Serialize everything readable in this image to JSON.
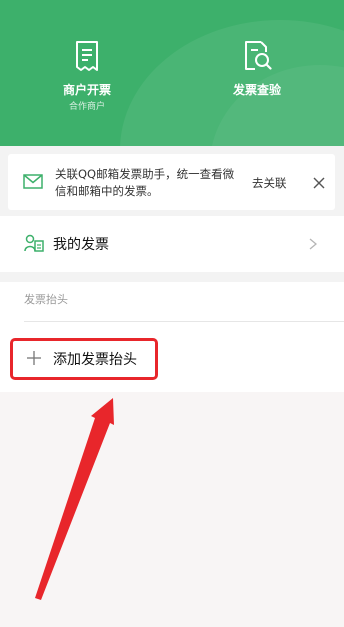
{
  "header": {
    "left_item": {
      "title": "商户开票",
      "subtitle": "合作商户",
      "icon": "receipt-icon"
    },
    "right_item": {
      "title": "发票查验",
      "icon": "invoice-search-icon"
    }
  },
  "notice": {
    "icon": "mail-icon",
    "text": "关联QQ邮箱发票助手，统一查看微信和邮箱中的发票。",
    "link_label": "去关联",
    "close_icon": "close-icon"
  },
  "my_invoices": {
    "icon": "person-invoice-icon",
    "label": "我的发票"
  },
  "title_section": {
    "label": "发票抬头",
    "add_label": "添加发票抬头"
  },
  "colors": {
    "brand_green": "#3db06b",
    "highlight_red": "#e8262b"
  }
}
